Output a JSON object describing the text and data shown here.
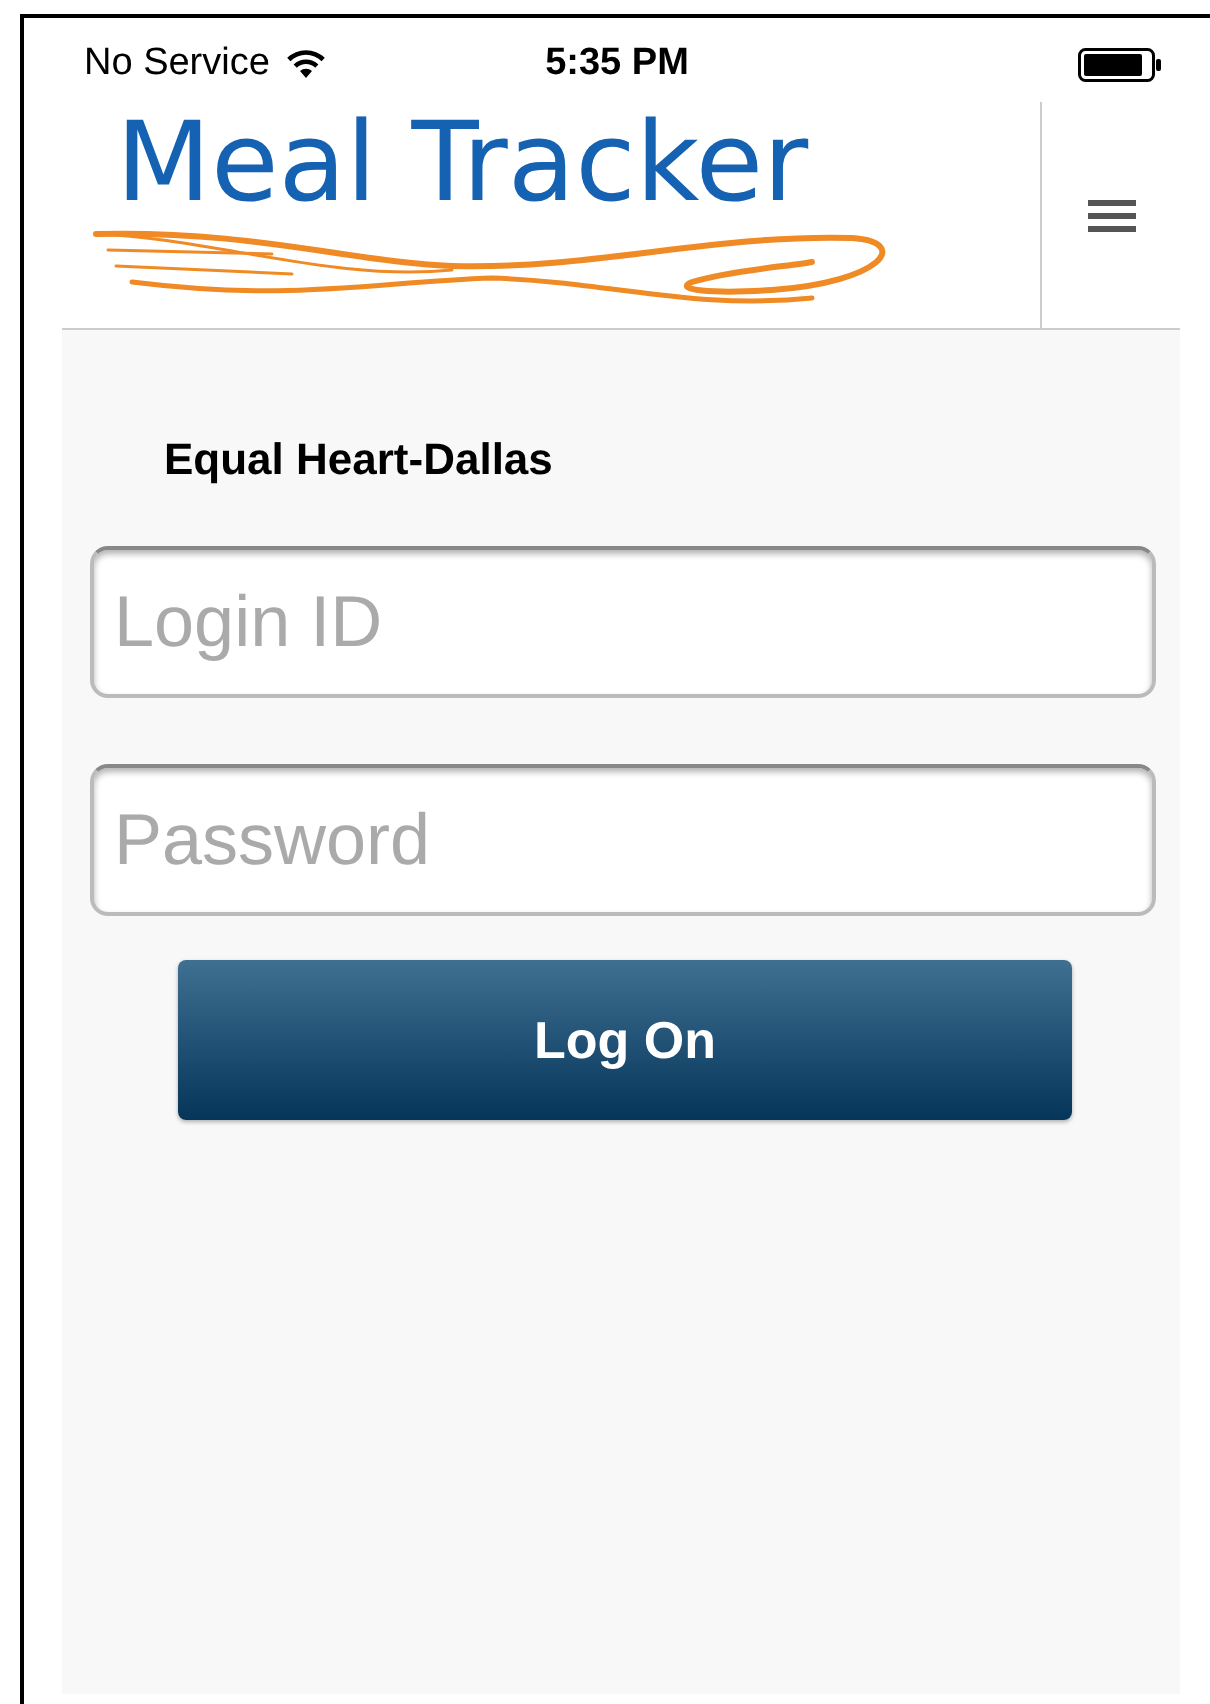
{
  "status_bar": {
    "carrier": "No Service",
    "time": "5:35 PM"
  },
  "header": {
    "logo_text": "Meal Tracker"
  },
  "organization": "Equal Heart-Dallas",
  "fields": [
    {
      "placeholder": "Login ID"
    },
    {
      "placeholder": "Password"
    }
  ],
  "button": {
    "label": "Log On"
  }
}
